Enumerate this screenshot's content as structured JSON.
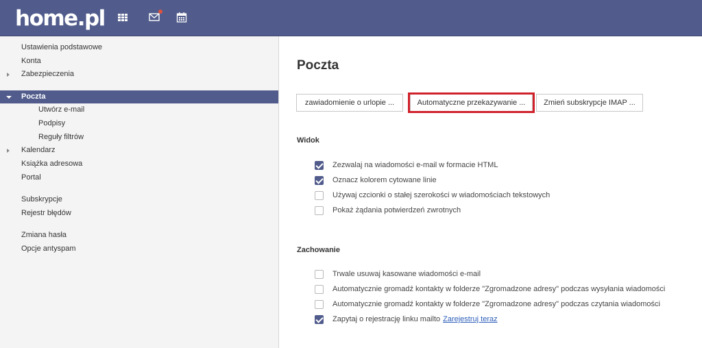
{
  "header": {
    "logo": "home.pl",
    "icons": [
      "apps-grid-icon",
      "mail-icon",
      "calendar-icon"
    ],
    "colors": {
      "bar": "#515c8c",
      "notification": "#e0533d"
    }
  },
  "sidebar": {
    "items": [
      {
        "label": "Ustawienia podstawowe"
      },
      {
        "label": "Konta"
      },
      {
        "label": "Zabezpieczenia",
        "collapsed": true
      },
      {
        "label": "Poczta",
        "expanded": true,
        "active": true
      },
      {
        "label": "Utwórz e-mail"
      },
      {
        "label": "Podpisy"
      },
      {
        "label": "Reguły filtrów"
      },
      {
        "label": "Kalendarz",
        "collapsed": true
      },
      {
        "label": "Książka adresowa"
      },
      {
        "label": "Portal"
      },
      {
        "label": "Subskrypcje"
      },
      {
        "label": "Rejestr błędów"
      },
      {
        "label": "Zmiana hasła"
      },
      {
        "label": "Opcje antyspam"
      }
    ]
  },
  "main": {
    "title": "Poczta",
    "buttons": [
      {
        "label": "zawiadomienie o urlopie ..."
      },
      {
        "label": "Automatyczne przekazywanie ...",
        "highlighted": true
      },
      {
        "label": "Zmień subskrypcje IMAP ..."
      }
    ],
    "sections": [
      {
        "heading": "Widok",
        "options": [
          {
            "label": "Zezwalaj na wiadomości e-mail w formacie HTML",
            "checked": true
          },
          {
            "label": "Oznacz kolorem cytowane linie",
            "checked": true
          },
          {
            "label": "Używaj czcionki o stałej szerokości w wiadomościach tekstowych",
            "checked": false
          },
          {
            "label": "Pokaż żądania potwierdzeń zwrotnych",
            "checked": false
          }
        ]
      },
      {
        "heading": "Zachowanie",
        "options": [
          {
            "label": "Trwale usuwaj kasowane wiadomości e-mail",
            "checked": false
          },
          {
            "label": "Automatycznie gromadź kontakty w folderze \"Zgromadzone adresy\" podczas wysyłania wiadomości",
            "checked": false
          },
          {
            "label": "Automatycznie gromadź kontakty w folderze \"Zgromadzone adresy\" podczas czytania wiadomości",
            "checked": false
          },
          {
            "label": "Zapytaj o rejestrację linku mailto",
            "checked": true,
            "link": "Zarejestruj teraz"
          }
        ]
      }
    ],
    "highlight_color": "#d0202a"
  }
}
